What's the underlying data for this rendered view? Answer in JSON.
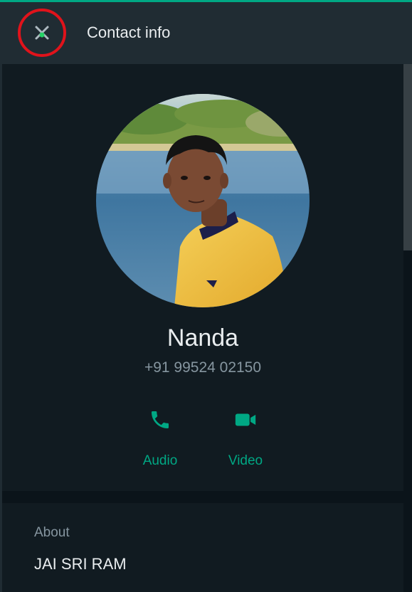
{
  "header": {
    "title": "Contact info",
    "close_icon": "close-icon"
  },
  "contact": {
    "name": "Nanda",
    "phone": "+91 99524 02150",
    "avatar_icon": "profile-photo"
  },
  "actions": [
    {
      "label": "Audio",
      "icon": "phone-icon"
    },
    {
      "label": "Video",
      "icon": "video-camera-icon"
    }
  ],
  "about": {
    "label": "About",
    "text": "JAI SRI RAM"
  },
  "colors": {
    "accent": "#00a884",
    "header_bg": "#202c33",
    "panel_bg": "#111b21",
    "page_bg": "#0b141a",
    "primary_text": "#e9edef",
    "secondary_text": "#8696a0",
    "highlight_ring": "#e0131b"
  }
}
